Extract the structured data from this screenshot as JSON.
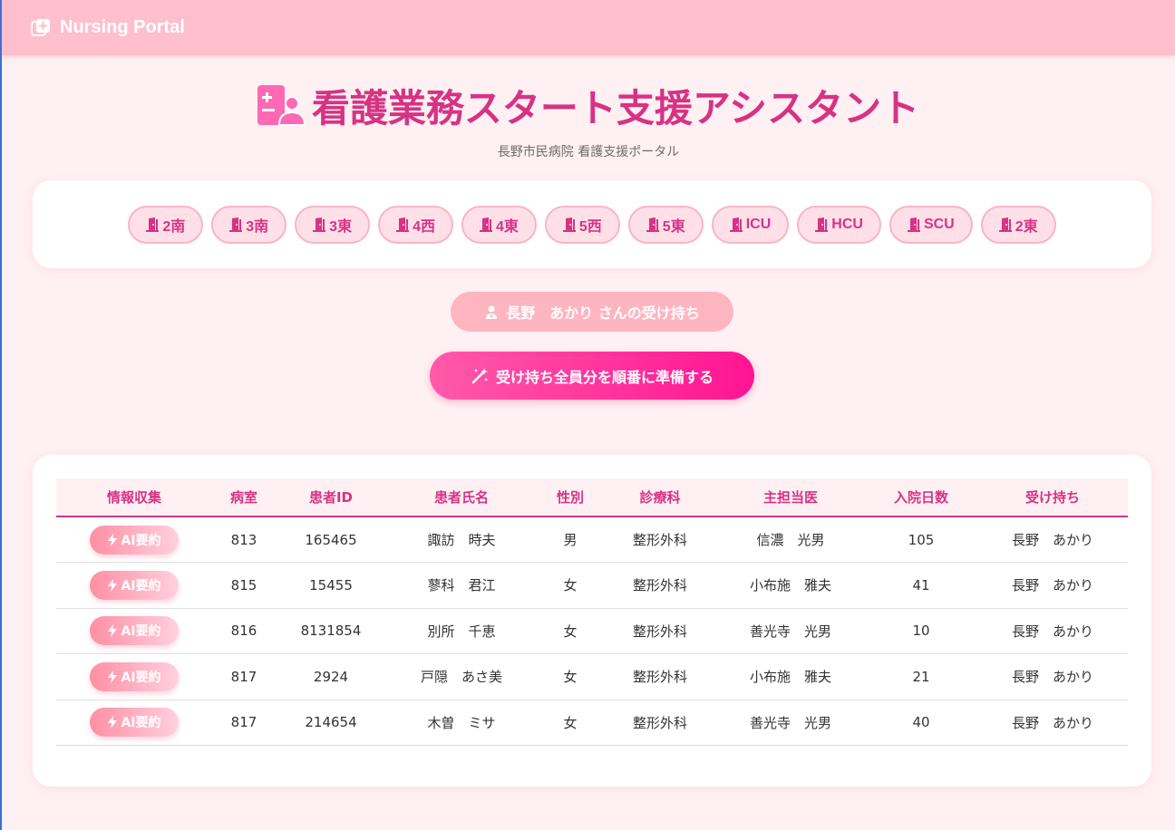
{
  "navbar": {
    "brand": "Nursing Portal"
  },
  "header": {
    "title": "看護業務スタート支援アシスタント",
    "subtitle": "長野市民病院 看護支援ポータル"
  },
  "wards": [
    "2南",
    "3南",
    "3東",
    "4西",
    "4東",
    "5西",
    "5東",
    "ICU",
    "HCU",
    "SCU",
    "2東"
  ],
  "nurse": {
    "label": "長野　あかり さんの受け持ち"
  },
  "prepare_button": {
    "label": "受け持ち全員分を順番に準備する"
  },
  "table": {
    "columns": [
      "情報収集",
      "病室",
      "患者ID",
      "患者氏名",
      "性別",
      "診療科",
      "主担当医",
      "入院日数",
      "受け持ち"
    ],
    "ai_button_label": "AI要約",
    "rows": [
      {
        "room": "813",
        "patient_id": "165465",
        "name": "諏訪　時夫",
        "sex": "男",
        "dept": "整形外科",
        "doctor": "信濃　光男",
        "days": "105",
        "nurse": "長野　あかり"
      },
      {
        "room": "815",
        "patient_id": "15455",
        "name": "蓼科　君江",
        "sex": "女",
        "dept": "整形外科",
        "doctor": "小布施　雅夫",
        "days": "41",
        "nurse": "長野　あかり"
      },
      {
        "room": "816",
        "patient_id": "8131854",
        "name": "別所　千恵",
        "sex": "女",
        "dept": "整形外科",
        "doctor": "善光寺　光男",
        "days": "10",
        "nurse": "長野　あかり"
      },
      {
        "room": "817",
        "patient_id": "2924",
        "name": "戸隠　あさ美",
        "sex": "女",
        "dept": "整形外科",
        "doctor": "小布施　雅夫",
        "days": "21",
        "nurse": "長野　あかり"
      },
      {
        "room": "817",
        "patient_id": "214654",
        "name": "木曽　ミサ",
        "sex": "女",
        "dept": "整形外科",
        "doctor": "善光寺　光男",
        "days": "40",
        "nurse": "長野　あかり"
      }
    ]
  },
  "colors": {
    "accent": "#d63384",
    "navbar": "#ffbfcc",
    "primary_button": "#ff1493"
  }
}
